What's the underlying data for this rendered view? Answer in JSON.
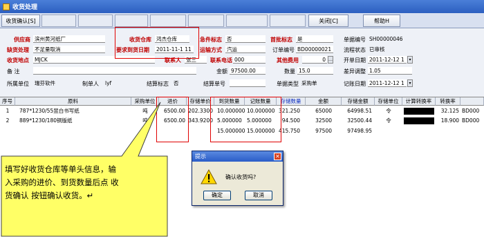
{
  "window": {
    "title": "收货处理"
  },
  "toolbar": {
    "confirm_label": "收货确认[S]",
    "close_label": "关闭[C]",
    "help_label": "帮助H"
  },
  "form": {
    "supplier_label": "供应商",
    "supplier_value": "滨州黄河纸厂",
    "warehouse_label": "收货仓库",
    "warehouse_value": "鸿杰仓库",
    "urgent_label": "急件标志",
    "urgent_value": "否",
    "first_batch_label": "首批标志",
    "first_batch_value": "是",
    "doc_no_label": "单据编号",
    "doc_no_value": "SH00000046",
    "shortage_label": "缺货处理",
    "shortage_value": "不足量取消",
    "required_date_label": "要求到货日期",
    "required_date_value": "2011-11-1 11",
    "ship_method_label": "运输方式",
    "ship_method_value": "汽运",
    "order_no_label": "订单编号",
    "order_no_value": "BD00000021",
    "flow_status_label": "流程状态",
    "flow_status_value": "已审核",
    "location_label": "收货地点",
    "location_value": "MJCK",
    "contact_label": "联系人",
    "contact_value": "张三",
    "phone_label": "联系电话",
    "phone_value": "000",
    "other_fee_label": "其他费用",
    "other_fee_value": "0",
    "open_date_label": "开单日期",
    "open_date_value": "2011-12-12 1",
    "remark_label": "备    注",
    "remark_value": "",
    "amount_label": "金额",
    "amount_value": "97500.00",
    "quantity_label": "数量",
    "quantity_value": "15.0",
    "diff_adjust_label": "差异调整",
    "diff_adjust_value": "1.05",
    "owner_unit_label": "所属单位",
    "owner_unit_value": "瑞芬软件",
    "maker_label": "制单人",
    "maker_value": "lyf",
    "settle_flag_label": "结算标志",
    "settle_flag_value": "否",
    "settle_no_label": "结算单号",
    "settle_no_value": "",
    "doc_type_label": "单据类型",
    "doc_type_value": "采购单",
    "posting_date_label": "记账日期",
    "posting_date_value": "2011-12-12 1"
  },
  "grid": {
    "headers": [
      "序号",
      "原料",
      "采购单位",
      "进价",
      "存储单价",
      "到货数量",
      "记账数量",
      "存储数量",
      "金额",
      "存储金额",
      "存储单位",
      "计算转换率",
      "转换率"
    ],
    "rows": [
      {
        "no": "1",
        "material": "787*1230/55昱白书写纸",
        "unit": "吨",
        "price": "6500.00",
        "store_price": "202.3300",
        "arrive_qty": "10.000000",
        "book_qty": "10.000000",
        "store_qty": "321.250",
        "amount": "65000",
        "store_amount": "64998.51",
        "store_unit": "令",
        "rate": "32.125",
        "extra": "BD000"
      },
      {
        "no": "2",
        "material": "889*1230/180铜版纸",
        "unit": "吨",
        "price": "6500.00",
        "store_price": "343.9200",
        "arrive_qty": "5.000000",
        "book_qty": "5.000000",
        "store_qty": "94.500",
        "amount": "32500",
        "store_amount": "32500.44",
        "store_unit": "令",
        "rate": "18.900",
        "extra": "BD000"
      }
    ],
    "total": {
      "arrive_qty": "15.000000",
      "book_qty": "15.000000",
      "store_qty": "415.750",
      "amount": "97500",
      "store_amount": "97498.95"
    }
  },
  "dialog": {
    "title": "提示",
    "message": "确认收货吗?",
    "ok_label": "确定",
    "cancel_label": "取消"
  },
  "callout": {
    "line1": "填写好收货仓库等单头信息，输",
    "line2": "入采购的进价、到货数量后点 收",
    "line3": "货确认 按钮确认收货。↵"
  },
  "colors": {
    "title_bar": "#2c5fc0",
    "required_label": "#c00000",
    "highlight_box": "#e00000",
    "callout_fill": "#ffff66"
  }
}
